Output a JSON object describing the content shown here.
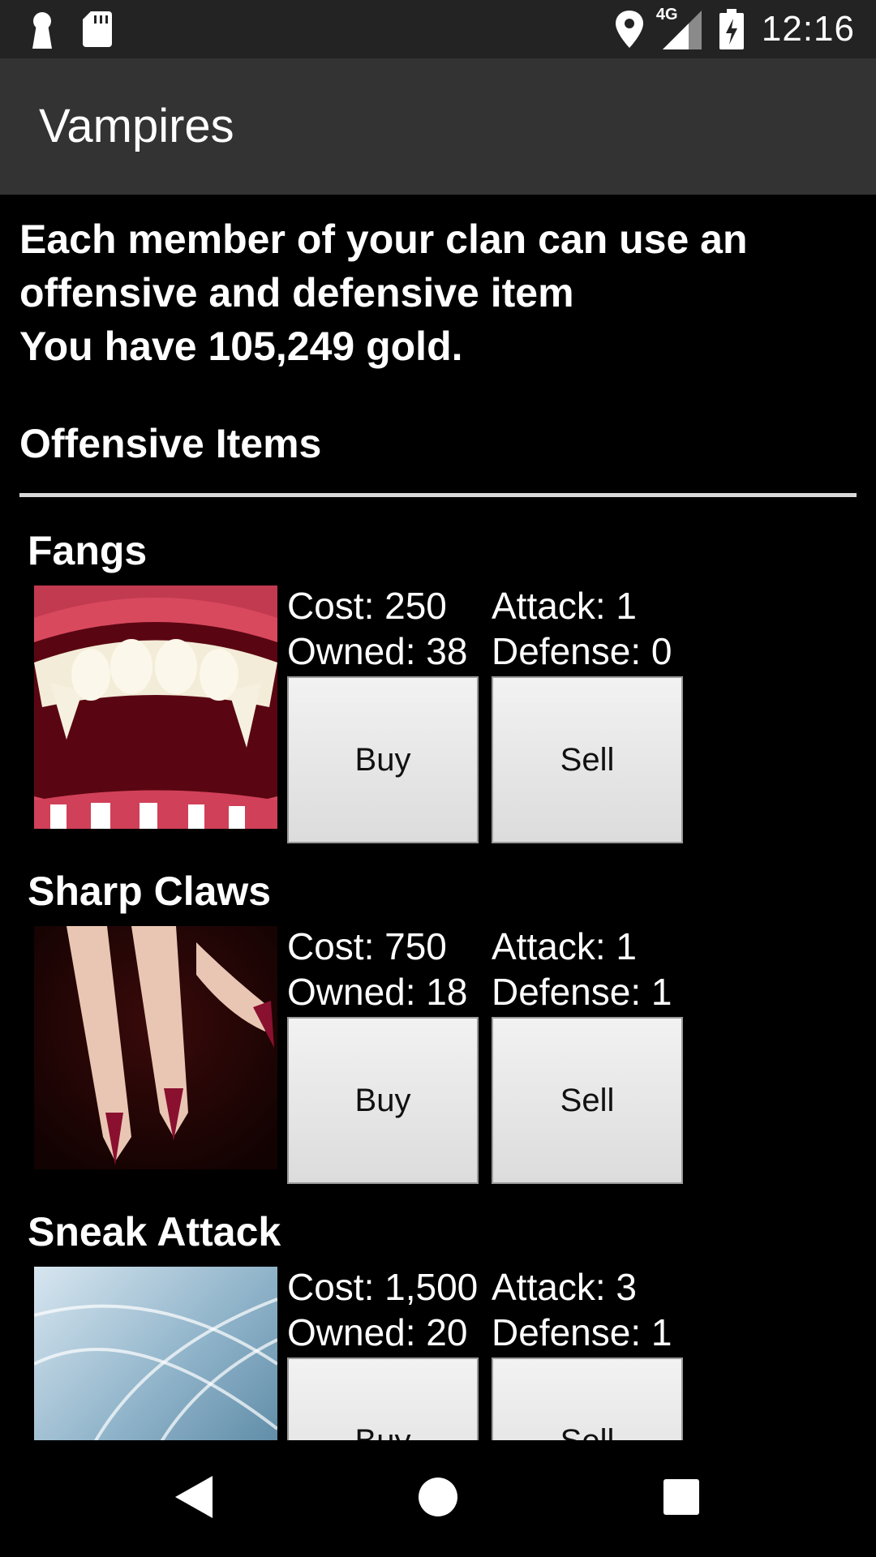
{
  "status_bar": {
    "time": "12:16",
    "network": "4G",
    "icons": [
      "keyhole-icon",
      "sd-card-icon",
      "location-icon",
      "signal-icon",
      "battery-icon"
    ]
  },
  "app_bar": {
    "title": "Vampires"
  },
  "intro": {
    "line1": "Each member of your clan can use an",
    "line2": "offensive and defensive item",
    "gold": "You have 105,249 gold."
  },
  "section": {
    "title": "Offensive Items"
  },
  "items": [
    {
      "name": "Fangs",
      "cost": "Cost: 250",
      "attack": "Attack: 1",
      "owned": "Owned: 38",
      "defense": "Defense: 0",
      "buy": "Buy",
      "sell": "Sell",
      "image": "fangs-image"
    },
    {
      "name": "Sharp Claws",
      "cost": "Cost: 750",
      "attack": "Attack: 1",
      "owned": "Owned: 18",
      "defense": "Defense: 1",
      "buy": "Buy",
      "sell": "Sell",
      "image": "claws-image"
    },
    {
      "name": "Sneak Attack",
      "cost": "Cost: 1,500",
      "attack": "Attack: 3",
      "owned": "Owned: 20",
      "defense": "Defense: 1",
      "buy": "Buy",
      "sell": "Sell",
      "image": "sneak-attack-image"
    }
  ],
  "nav_bar": {
    "icons": [
      "back-icon",
      "home-icon",
      "recents-icon"
    ]
  }
}
